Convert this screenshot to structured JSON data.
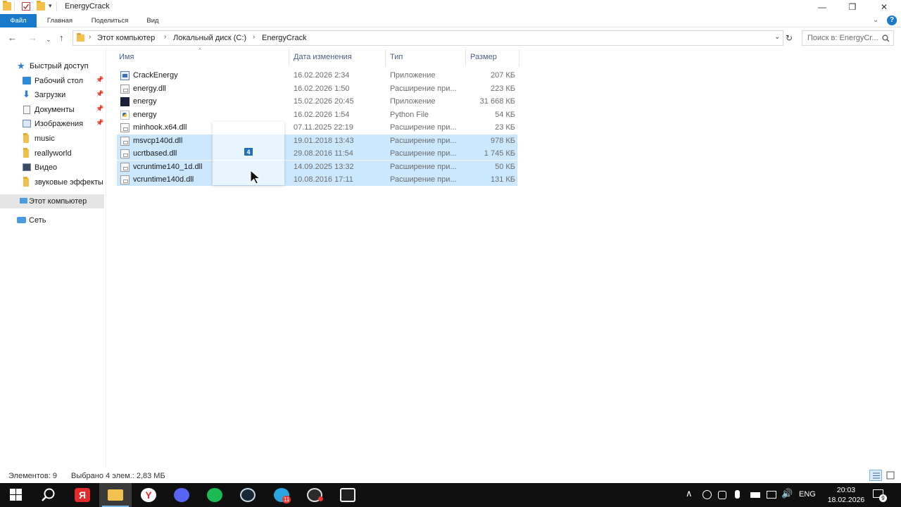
{
  "window": {
    "title": "EnergyCrack",
    "controls": {
      "minimize": "—",
      "restore": "❐",
      "close": "✕"
    }
  },
  "ribbon": {
    "tabs": [
      "Файл",
      "Главная",
      "Поделиться",
      "Вид"
    ]
  },
  "address": {
    "crumbs": [
      "Этот компьютер",
      "Локальный диск (C:)",
      "EnergyCrack"
    ],
    "search_placeholder": "Поиск в: EnergyCr..."
  },
  "nav": {
    "quick_access": "Быстрый доступ",
    "items": [
      {
        "label": "Рабочий стол",
        "icon": "desktop-icon",
        "pinned": true
      },
      {
        "label": "Загрузки",
        "icon": "download-icon",
        "pinned": true
      },
      {
        "label": "Документы",
        "icon": "documents-icon",
        "pinned": true
      },
      {
        "label": "Изображения",
        "icon": "pictures-icon",
        "pinned": true
      },
      {
        "label": "music",
        "icon": "folder-icon",
        "pinned": false
      },
      {
        "label": "reallyworld",
        "icon": "folder-icon",
        "pinned": false
      },
      {
        "label": "Видео",
        "icon": "video-icon",
        "pinned": false
      },
      {
        "label": "звуковые эффекты",
        "icon": "folder-icon",
        "pinned": false
      }
    ],
    "this_pc": "Этот компьютер",
    "network": "Сеть"
  },
  "columns": {
    "name": "Имя",
    "date": "Дата изменения",
    "type": "Тип",
    "size": "Размер"
  },
  "files": [
    {
      "name": "CrackEnergy",
      "date": "16.02.2026 2:34",
      "type": "Приложение",
      "size": "207 КБ",
      "icon": "app-icon",
      "selected": false
    },
    {
      "name": "energy.dll",
      "date": "16.02.2026 1:50",
      "type": "Расширение при...",
      "size": "223 КБ",
      "icon": "dll-icon",
      "selected": false
    },
    {
      "name": "energy",
      "date": "15.02.2026 20:45",
      "type": "Приложение",
      "size": "31 668 КБ",
      "icon": "energy-app-icon",
      "selected": false
    },
    {
      "name": "energy",
      "date": "16.02.2026 1:54",
      "type": "Python File",
      "size": "54 КБ",
      "icon": "python-file-icon",
      "selected": false
    },
    {
      "name": "minhook.x64.dll",
      "date": "07.11.2025 22:19",
      "type": "Расширение при...",
      "size": "23 КБ",
      "icon": "dll-icon",
      "selected": false
    },
    {
      "name": "msvcp140d.dll",
      "date": "19.01.2018 13:43",
      "type": "Расширение при...",
      "size": "978 КБ",
      "icon": "dll-icon",
      "selected": true
    },
    {
      "name": "ucrtbased.dll",
      "date": "29.08.2016 11:54",
      "type": "Расширение при...",
      "size": "1 745 КБ",
      "icon": "dll-icon",
      "selected": true
    },
    {
      "name": "vcruntime140_1d.dll",
      "date": "14.09.2025 13:32",
      "type": "Расширение при...",
      "size": "50 КБ",
      "icon": "dll-icon",
      "selected": true
    },
    {
      "name": "vcruntime140d.dll",
      "date": "10.08.2016 17:11",
      "type": "Расширение при...",
      "size": "131 КБ",
      "icon": "dll-icon",
      "selected": true
    }
  ],
  "drag": {
    "count": "4"
  },
  "status": {
    "items": "Элементов: 9",
    "selected": "Выбрано 4 элем.: 2,83 МБ"
  },
  "taskbar": {
    "apps": [
      {
        "name": "search",
        "color": "#101010"
      },
      {
        "name": "yandex-browser",
        "color": "#e32b2b"
      },
      {
        "name": "file-explorer",
        "color": "#f2c04c"
      },
      {
        "name": "yandex",
        "color": "#ffffff"
      },
      {
        "name": "discord",
        "color": "#5865f2"
      },
      {
        "name": "spotify",
        "color": "#1db954"
      },
      {
        "name": "steam",
        "color": "#1b2838"
      },
      {
        "name": "telegram",
        "color": "#2aa3df"
      },
      {
        "name": "obs-like",
        "color": "#2b2b2b"
      },
      {
        "name": "ea-app",
        "color": "#1e1e1e"
      }
    ],
    "telegram_badge": "11",
    "language": "ENG",
    "time": "20:03",
    "date": "18.02.2026",
    "notifications": "9"
  },
  "colors": {
    "accent": "#1979ca",
    "selection": "#cce8ff",
    "taskbar": "#101010"
  }
}
